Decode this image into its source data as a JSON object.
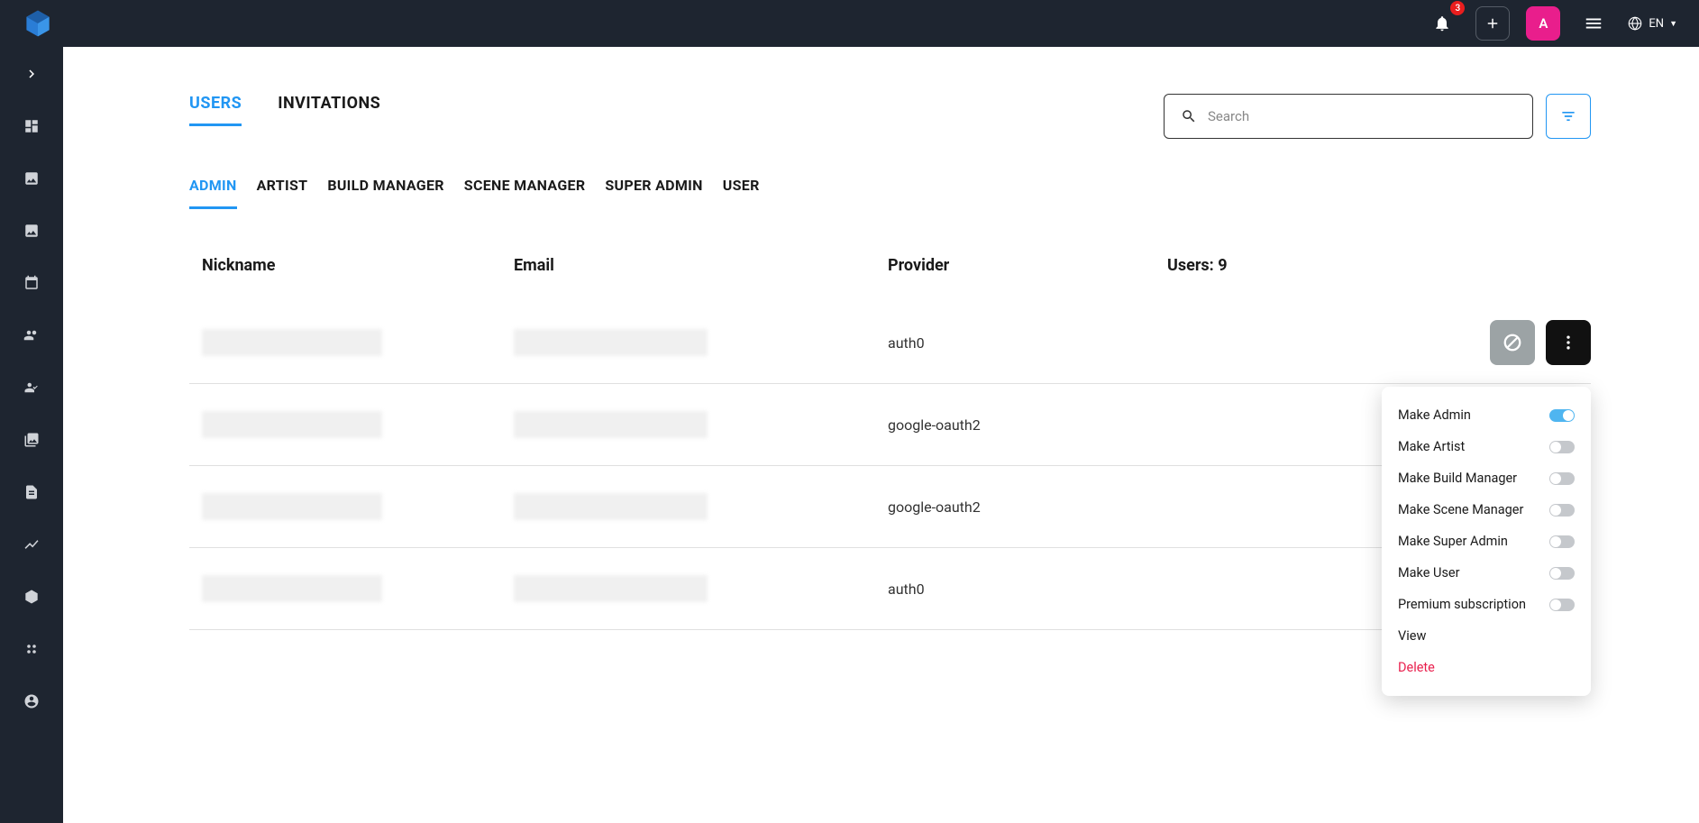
{
  "topbar": {
    "notif_count": "3",
    "avatar_initial": "A",
    "lang_label": "EN"
  },
  "tabs_primary": [
    {
      "label": "USERS",
      "active": true
    },
    {
      "label": "INVITATIONS",
      "active": false
    }
  ],
  "search": {
    "placeholder": "Search"
  },
  "tabs_secondary": [
    {
      "label": "ADMIN",
      "active": true
    },
    {
      "label": "ARTIST",
      "active": false
    },
    {
      "label": "BUILD MANAGER",
      "active": false
    },
    {
      "label": "SCENE MANAGER",
      "active": false
    },
    {
      "label": "SUPER ADMIN",
      "active": false
    },
    {
      "label": "USER",
      "active": false
    }
  ],
  "table": {
    "headers": {
      "nickname": "Nickname",
      "email": "Email",
      "provider": "Provider",
      "users_count": "Users: 9"
    },
    "rows": [
      {
        "provider": "auth0",
        "menu_open": true
      },
      {
        "provider": "google-oauth2",
        "menu_open": false
      },
      {
        "provider": "google-oauth2",
        "menu_open": false
      },
      {
        "provider": "auth0",
        "menu_open": false
      }
    ]
  },
  "dropdown": {
    "items": [
      {
        "label": "Make Admin",
        "toggle": true,
        "on": true
      },
      {
        "label": "Make Artist",
        "toggle": true,
        "on": false
      },
      {
        "label": "Make Build Manager",
        "toggle": true,
        "on": false
      },
      {
        "label": "Make Scene Manager",
        "toggle": true,
        "on": false
      },
      {
        "label": "Make Super Admin",
        "toggle": true,
        "on": false
      },
      {
        "label": "Make User",
        "toggle": true,
        "on": false
      },
      {
        "label": "Premium subscription",
        "toggle": true,
        "on": false
      },
      {
        "label": "View",
        "toggle": false
      },
      {
        "label": "Delete",
        "toggle": false,
        "danger": true
      }
    ]
  }
}
